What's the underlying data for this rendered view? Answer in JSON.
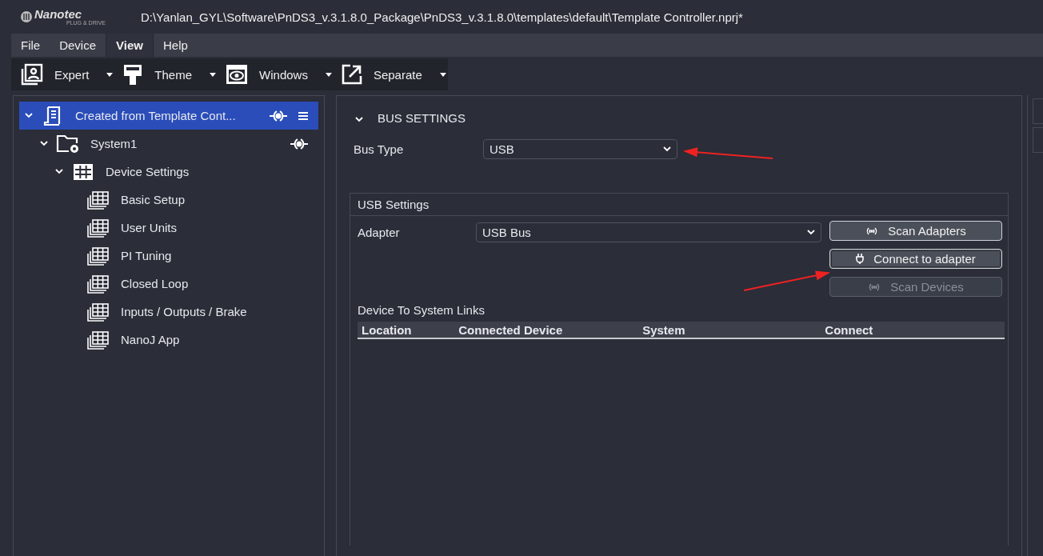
{
  "app": {
    "logo": "Nanotec",
    "logo_tagline": "PLUG & DRIVE",
    "title": "D:\\Yanlan_GYL\\Software\\PnDS3_v.3.1.8.0_Package\\PnDS3_v.3.1.8.0\\templates\\default\\Template Controller.nprj*"
  },
  "menu": [
    {
      "label": "File",
      "selected": false
    },
    {
      "label": "Device",
      "selected": false
    },
    {
      "label": "View",
      "selected": true
    },
    {
      "label": "Help",
      "selected": false
    }
  ],
  "toolbar": [
    {
      "label": "Expert",
      "kind": "portrait"
    },
    {
      "label": "Theme",
      "kind": "brush"
    },
    {
      "label": "Windows",
      "kind": "eye"
    },
    {
      "label": "Separate",
      "kind": "external"
    }
  ],
  "tree": [
    {
      "label": "Created from Template Cont...",
      "kind": "project",
      "selected": true,
      "expanded": true,
      "link_button": true,
      "menu_button": true,
      "children": [
        {
          "label": "System1",
          "kind": "system",
          "selected": false,
          "expanded": true,
          "link_button": true,
          "menu_button": false,
          "children": [
            {
              "label": "Device Settings",
              "kind": "grid",
              "selected": false,
              "expanded": true,
              "children": [
                {
                  "label": "Basic Setup",
                  "kind": "page",
                  "selected": false
                },
                {
                  "label": "User Units",
                  "kind": "page",
                  "selected": false
                },
                {
                  "label": "PI Tuning",
                  "kind": "page",
                  "selected": false
                },
                {
                  "label": "Closed Loop",
                  "kind": "page",
                  "selected": false
                },
                {
                  "label": "Inputs / Outputs / Brake",
                  "kind": "page",
                  "selected": false
                },
                {
                  "label": "NanoJ App",
                  "kind": "page",
                  "selected": false
                }
              ]
            }
          ]
        }
      ]
    }
  ],
  "bus_settings": {
    "title": "BUS SETTINGS",
    "expanded": true,
    "bus_type_label": "Bus Type",
    "bus_type": "USB",
    "usb_settings": {
      "title": "USB Settings",
      "adapter_label": "Adapter",
      "adapter": "USB Bus",
      "buttons": [
        {
          "label": "Scan Adapters",
          "kind": "scan",
          "disabled": false,
          "focused": false
        },
        {
          "label": "Connect to adapter",
          "kind": "plug",
          "disabled": false,
          "focused": true
        },
        {
          "label": "Scan Devices",
          "kind": "scan",
          "disabled": true,
          "focused": false
        }
      ],
      "links_title": "Device To System Links",
      "table": {
        "columns": [
          "Location",
          "Connected Device",
          "System",
          "Connect"
        ]
      }
    }
  },
  "annotations": [
    {
      "kind": "arrow"
    },
    {
      "kind": "arrow"
    }
  ]
}
